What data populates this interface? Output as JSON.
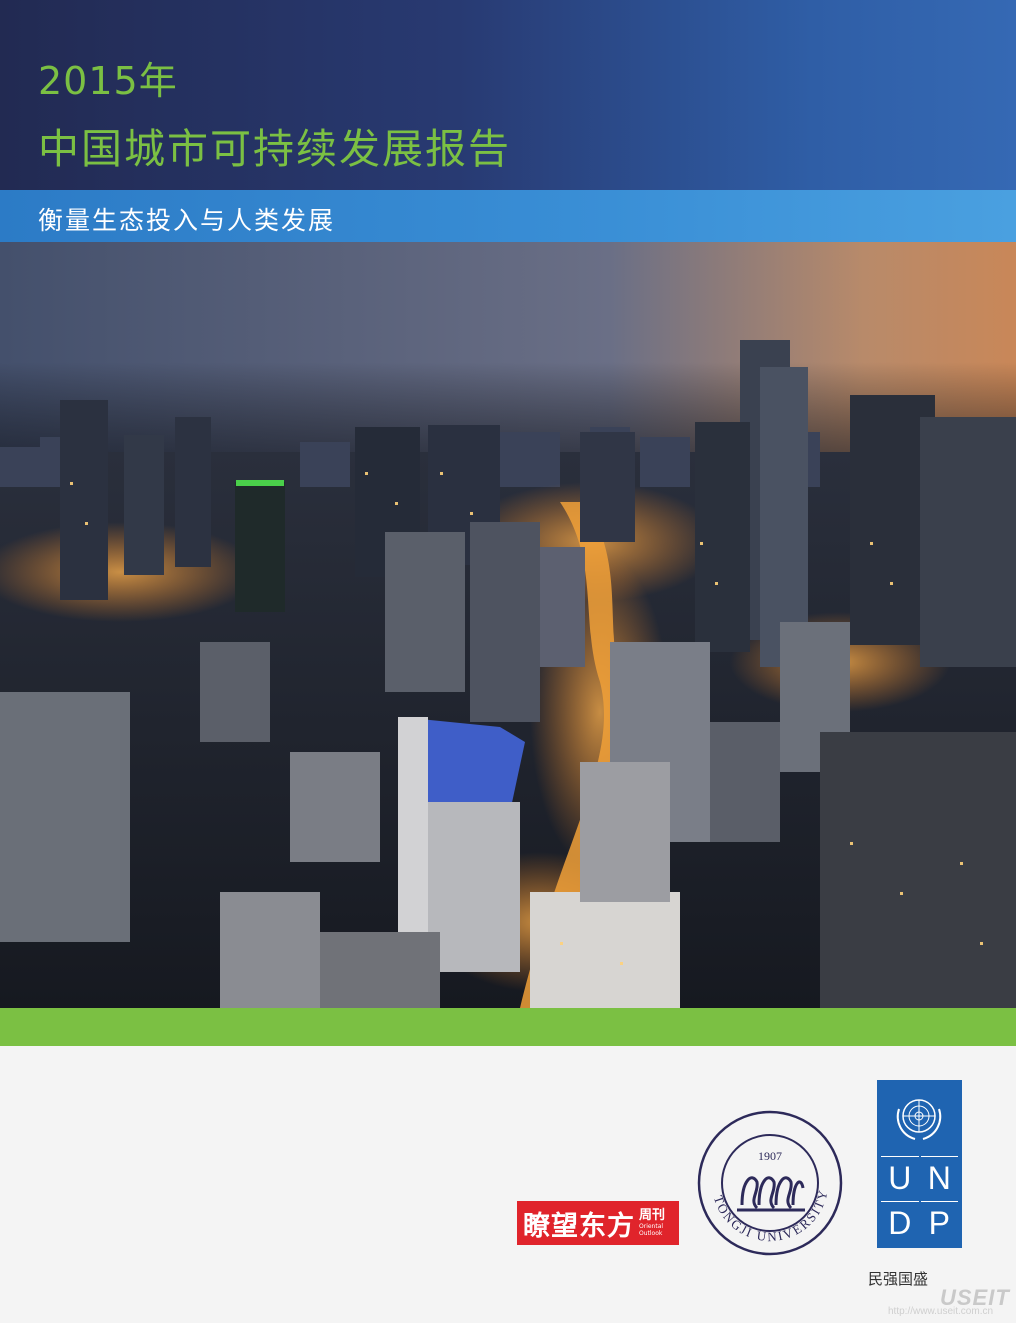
{
  "header": {
    "year": "2015年",
    "title": "中国城市可持续发展报告",
    "subtitle": "衡量生态投入与人类发展"
  },
  "colors": {
    "title_green": "#7bc043",
    "header_navy": "#222a52",
    "header_blue": "#3569b4",
    "subtitle_blue": "#3a8fd6",
    "band_green": "#7bc043",
    "undp_blue": "#1f64b1",
    "outlook_red": "#e0242b"
  },
  "cover_photo": {
    "subject": "aerial-night-cityscape"
  },
  "logos": {
    "outlook": {
      "main": "瞭望东方",
      "side_zh": "周刊",
      "side_en_line1": "Oriental",
      "side_en_line2": "Outlook"
    },
    "tongji": {
      "year": "1907",
      "ring_text": "TONGJI UNIVERSITY"
    },
    "undp": {
      "letters": [
        "U",
        "N",
        "D",
        "P"
      ],
      "tagline": "民强国盛"
    }
  },
  "watermark": {
    "brand": "USEIT",
    "url": "http://www.useit.com.cn"
  }
}
